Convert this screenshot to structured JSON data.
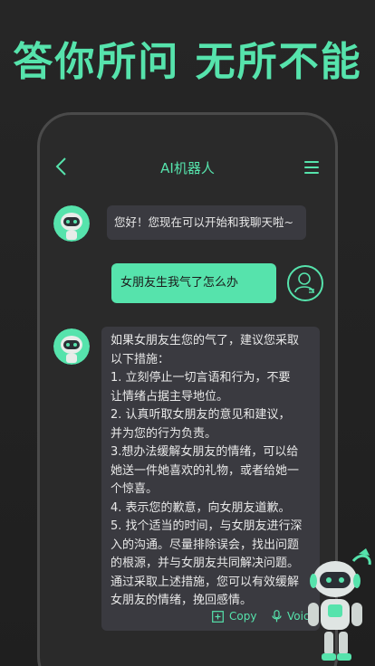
{
  "headline": "答你所问 无所不能",
  "header": {
    "title": "AI机器人"
  },
  "messages": {
    "greeting": "您好！您现在可以开始和我聊天啦~",
    "user_question": "女朋友生我气了怎么办",
    "answer_lines": [
      "如果女朋友生您的气了，建议您采取",
      "以下措施：",
      "1.   立刻停止一切言语和行为，不要",
      "让情绪占据主导地位。",
      "2.   认真听取女朋友的意见和建议，",
      "并为您的行为负责。",
      "3.想办法缓解女朋友的情绪，可以给",
      "她送一件她喜欢的礼物，或者给她一",
      "个惊喜。",
      "4. 表示您的歉意，向女朋友道歉。",
      "5. 找个适当的时间，与女朋友进行深",
      "入的沟通。尽量排除误会，找出问题",
      "的根源，并与女朋友共同解决问题。",
      "通过采取上述措施，您可以有效缓解",
      "女朋友的情绪，挽回感情。"
    ]
  },
  "actions": {
    "copy_label": "Copy",
    "voice_label": "Voice"
  },
  "colors": {
    "accent": "#56e3ac",
    "bubble_bot": "#3a3a40",
    "background": "#232323"
  }
}
